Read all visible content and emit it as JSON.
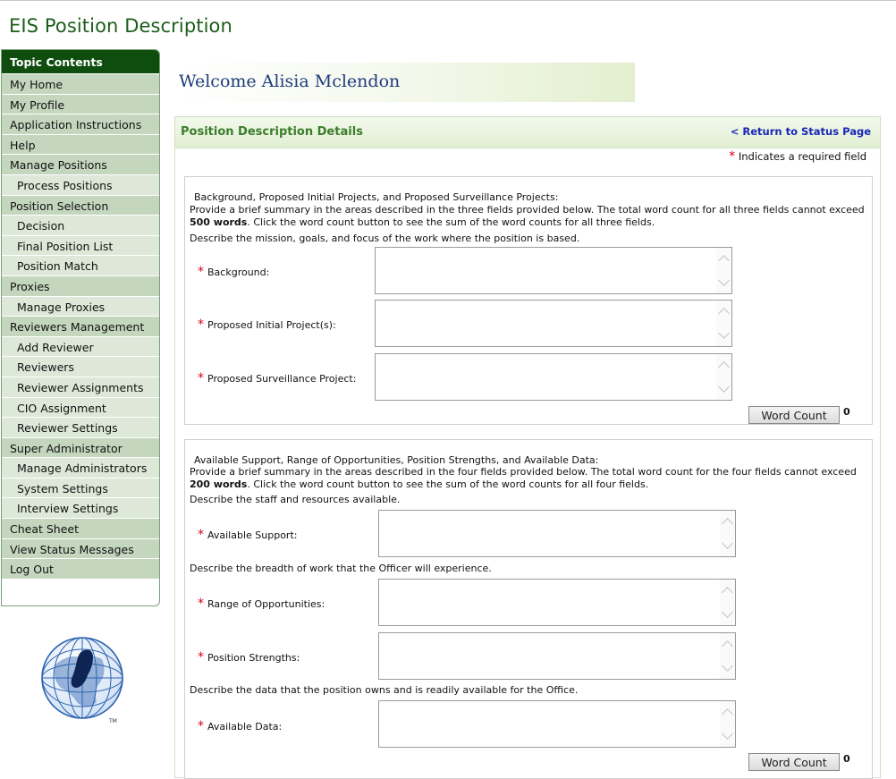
{
  "app_title": "EIS Position Description",
  "sidebar": {
    "header": "Topic Contents",
    "items": [
      {
        "label": "My Home",
        "level": "top"
      },
      {
        "label": "My Profile",
        "level": "top"
      },
      {
        "label": "Application Instructions",
        "level": "top"
      },
      {
        "label": "Help",
        "level": "top"
      },
      {
        "label": "Manage Positions",
        "level": "top"
      },
      {
        "label": "Process Positions",
        "level": "sub"
      },
      {
        "label": "Position Selection",
        "level": "top"
      },
      {
        "label": "Decision",
        "level": "sub"
      },
      {
        "label": "Final Position List",
        "level": "sub"
      },
      {
        "label": "Position Match",
        "level": "sub"
      },
      {
        "label": "Proxies",
        "level": "top"
      },
      {
        "label": "Manage Proxies",
        "level": "sub"
      },
      {
        "label": "Reviewers Management",
        "level": "top"
      },
      {
        "label": "Add Reviewer",
        "level": "sub"
      },
      {
        "label": "Reviewers",
        "level": "sub"
      },
      {
        "label": "Reviewer Assignments",
        "level": "sub"
      },
      {
        "label": "CIO Assignment",
        "level": "sub"
      },
      {
        "label": "Reviewer Settings",
        "level": "sub"
      },
      {
        "label": "Super Administrator",
        "level": "top"
      },
      {
        "label": "Manage Administrators",
        "level": "sub"
      },
      {
        "label": "System Settings",
        "level": "sub"
      },
      {
        "label": "Interview Settings",
        "level": "sub"
      },
      {
        "label": "Cheat Sheet",
        "level": "top"
      },
      {
        "label": "View Status Messages",
        "level": "top"
      },
      {
        "label": "Log Out",
        "level": "top"
      }
    ]
  },
  "welcome": "Welcome Alisia Mclendon",
  "panel": {
    "title": "Position Description Details",
    "return_link": "< Return to Status Page",
    "required_star": "*",
    "required_note": "Indicates a required field"
  },
  "section1": {
    "heading": "Background, Proposed Initial Projects, and Proposed Surveillance Projects:",
    "intro_a": "Provide a brief summary in the areas described in the three fields provided below. The total word count for all three fields cannot exceed",
    "intro_bold": "500 words",
    "intro_b": ". Click the word count button to see the sum of the word counts for all three fields.",
    "describe": "Describe the mission, goals, and focus of the work where the position is based.",
    "fields": [
      {
        "label": "Background:"
      },
      {
        "label": "Proposed Initial Project(s):"
      },
      {
        "label": "Proposed Surveillance Project:"
      }
    ],
    "button": "Word Count",
    "count": "0"
  },
  "section2": {
    "heading": "Available Support, Range of Opportunities, Position Strengths, and Available Data:",
    "intro_a": "Provide a brief summary in the areas described in the four fields provided below. The total word count for the four fields cannot exceed",
    "intro_bold": "200 words",
    "intro_b": ". Click the word count button to see the sum of the word counts for all four fields.",
    "describe_support": "Describe the staff and resources available.",
    "describe_range": "Describe the breadth of work that the Officer will experience.",
    "describe_data": "Describe the data that the position owns and is readily available for the Office.",
    "fields": [
      {
        "label": "Available Support:"
      },
      {
        "label": "Range of Opportunities:"
      },
      {
        "label": "Position Strengths:"
      },
      {
        "label": "Available Data:"
      }
    ],
    "button": "Word Count",
    "count": "0"
  },
  "logo_icon": "globe-footprint-icon",
  "logo_mark": "TM"
}
